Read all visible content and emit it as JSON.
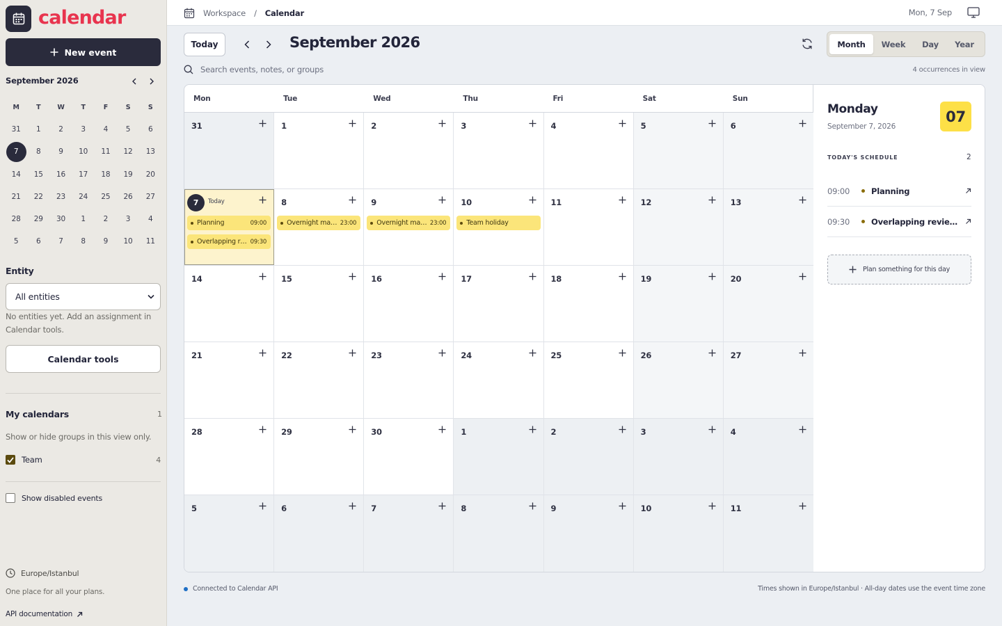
{
  "app": {
    "name": "calendar",
    "new_event_label": "New event"
  },
  "mini_calendar": {
    "title": "September 2026",
    "weekday_headers": [
      "M",
      "T",
      "W",
      "T",
      "F",
      "S",
      "S"
    ],
    "weeks": [
      [
        "31",
        "1",
        "2",
        "3",
        "4",
        "5",
        "6"
      ],
      [
        "7",
        "8",
        "9",
        "10",
        "11",
        "12",
        "13"
      ],
      [
        "14",
        "15",
        "16",
        "17",
        "18",
        "19",
        "20"
      ],
      [
        "21",
        "22",
        "23",
        "24",
        "25",
        "26",
        "27"
      ],
      [
        "28",
        "29",
        "30",
        "1",
        "2",
        "3",
        "4"
      ],
      [
        "5",
        "6",
        "7",
        "8",
        "9",
        "10",
        "11"
      ]
    ],
    "selected": "7"
  },
  "entity": {
    "label": "Entity",
    "selected": "All entities",
    "help": "No entities yet. Add an assignment in Calendar tools.",
    "tools_button": "Calendar tools"
  },
  "my_calendars": {
    "title": "My calendars",
    "count": "1",
    "help": "Show or hide groups in this view only.",
    "groups": [
      {
        "name": "Team",
        "count": "4",
        "checked": true
      }
    ],
    "show_disabled_label": "Show disabled events"
  },
  "sidebar_footer": {
    "timezone": "Europe/Istanbul",
    "tagline": "One place for all your plans.",
    "api_link": "API documentation"
  },
  "topbar": {
    "breadcrumb": [
      "Workspace",
      "Calendar"
    ],
    "date": "Mon, 7 Sep"
  },
  "toolbar": {
    "today_label": "Today",
    "title": "September 2026",
    "views": [
      "Month",
      "Week",
      "Day",
      "Year"
    ],
    "active_view": "Month"
  },
  "search": {
    "placeholder": "Search events, notes, or groups",
    "occurrences": "4 occurrences in view"
  },
  "month": {
    "weekdays": [
      "Mon",
      "Tue",
      "Wed",
      "Thu",
      "Fri",
      "Sat",
      "Sun"
    ],
    "today_label": "Today",
    "weeks": [
      [
        {
          "d": "31",
          "out": true
        },
        {
          "d": "1"
        },
        {
          "d": "2"
        },
        {
          "d": "3"
        },
        {
          "d": "4"
        },
        {
          "d": "5"
        },
        {
          "d": "6"
        }
      ],
      [
        {
          "d": "7",
          "today": true,
          "events": [
            {
              "name": "Planning",
              "time": "09:00"
            },
            {
              "name": "Overlapping re...",
              "time": "09:30"
            }
          ]
        },
        {
          "d": "8",
          "events": [
            {
              "name": "Overnight main...",
              "time": "23:00"
            }
          ]
        },
        {
          "d": "9",
          "events": [
            {
              "name": "Overnight main...",
              "time": "23:00"
            }
          ]
        },
        {
          "d": "10",
          "events": [
            {
              "name": "Team holiday",
              "time": ""
            }
          ]
        },
        {
          "d": "11"
        },
        {
          "d": "12"
        },
        {
          "d": "13"
        }
      ],
      [
        {
          "d": "14"
        },
        {
          "d": "15"
        },
        {
          "d": "16"
        },
        {
          "d": "17"
        },
        {
          "d": "18"
        },
        {
          "d": "19"
        },
        {
          "d": "20"
        }
      ],
      [
        {
          "d": "21"
        },
        {
          "d": "22"
        },
        {
          "d": "23"
        },
        {
          "d": "24"
        },
        {
          "d": "25"
        },
        {
          "d": "26"
        },
        {
          "d": "27"
        }
      ],
      [
        {
          "d": "28"
        },
        {
          "d": "29"
        },
        {
          "d": "30"
        },
        {
          "d": "1",
          "out": true
        },
        {
          "d": "2",
          "out": true
        },
        {
          "d": "3",
          "out": true
        },
        {
          "d": "4",
          "out": true
        }
      ],
      [
        {
          "d": "5",
          "out": true
        },
        {
          "d": "6",
          "out": true
        },
        {
          "d": "7",
          "out": true
        },
        {
          "d": "8",
          "out": true
        },
        {
          "d": "9",
          "out": true
        },
        {
          "d": "10",
          "out": true
        },
        {
          "d": "11",
          "out": true
        }
      ]
    ]
  },
  "day_panel": {
    "weekday": "Monday",
    "date": "September 7, 2026",
    "badge": "07",
    "schedule_label": "TODAY'S SCHEDULE",
    "schedule_count": "2",
    "items": [
      {
        "time": "09:00",
        "name": "Planning"
      },
      {
        "time": "09:30",
        "name": "Overlapping review ..."
      }
    ],
    "plan_label": "Plan something for this day"
  },
  "footer": {
    "status": "Connected to Calendar API",
    "note": "Times shown in Europe/Istanbul · All-day dates use the event time zone"
  },
  "colors": {
    "brand": "#e8344e",
    "dark": "#2a2b3c",
    "event": "#fbe57a",
    "today_bg": "#fdf3cd",
    "badge": "#fde047",
    "status": "#1f6fc5"
  }
}
